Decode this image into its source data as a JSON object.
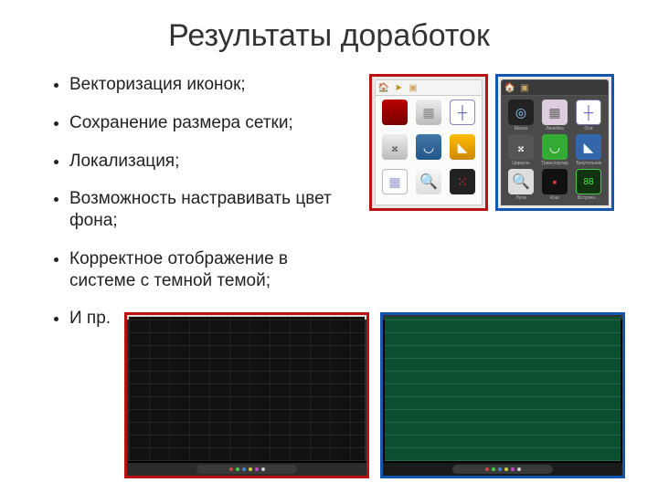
{
  "title": "Результаты доработок",
  "bullets": [
    "Векторизация иконок;",
    "Сохранение размера сетки;",
    "Локализация;",
    "Возможность настравивать цвет фона;",
    "Корректное отображение в системе с темной темой;",
    "И пр."
  ],
  "panels": {
    "old": {
      "frame": "red",
      "toolbar_icons": [
        "home",
        "arrow",
        "folder"
      ],
      "tiles": [
        {
          "name": "curtain",
          "glyph": "▮",
          "label": ""
        },
        {
          "name": "ruler",
          "glyph": "▤",
          "label": ""
        },
        {
          "name": "graph",
          "glyph": "┼",
          "label": ""
        },
        {
          "name": "compass",
          "glyph": "✕",
          "label": ""
        },
        {
          "name": "protractor",
          "glyph": "◠",
          "label": ""
        },
        {
          "name": "triangle",
          "glyph": "◣",
          "label": ""
        },
        {
          "name": "paper",
          "glyph": "▤",
          "label": ""
        },
        {
          "name": "loupe",
          "glyph": "🔍",
          "label": ""
        },
        {
          "name": "dice",
          "glyph": "⁘",
          "label": ""
        }
      ]
    },
    "new": {
      "frame": "blue",
      "toolbar_icons": [
        "home",
        "folder"
      ],
      "tiles": [
        {
          "name": "mask",
          "glyph": "◉",
          "label": "Маска"
        },
        {
          "name": "ruler",
          "glyph": "▤",
          "label": "Линейка"
        },
        {
          "name": "graph",
          "glyph": "┼",
          "label": "Оси"
        },
        {
          "name": "compass",
          "glyph": "Ⓐ",
          "label": "Циркуль"
        },
        {
          "name": "protractor",
          "glyph": "◠",
          "label": "Транспортир"
        },
        {
          "name": "triangle",
          "glyph": "◣",
          "label": "Треугольник"
        },
        {
          "name": "loupe",
          "glyph": "🔍",
          "label": "Лупа"
        },
        {
          "name": "cache",
          "glyph": "▪",
          "label": "Кэш"
        },
        {
          "name": "timer",
          "glyph": "88",
          "label": "Встроен…"
        }
      ]
    }
  },
  "screens": {
    "left": {
      "frame": "red",
      "canvas": "black",
      "chrome": "light"
    },
    "right": {
      "frame": "blue",
      "canvas": "green",
      "chrome": "dark"
    }
  },
  "toolstrip_colors": [
    "#c44",
    "#4c4",
    "#48c",
    "#cc4",
    "#c4c",
    "#ccc",
    "#888"
  ]
}
